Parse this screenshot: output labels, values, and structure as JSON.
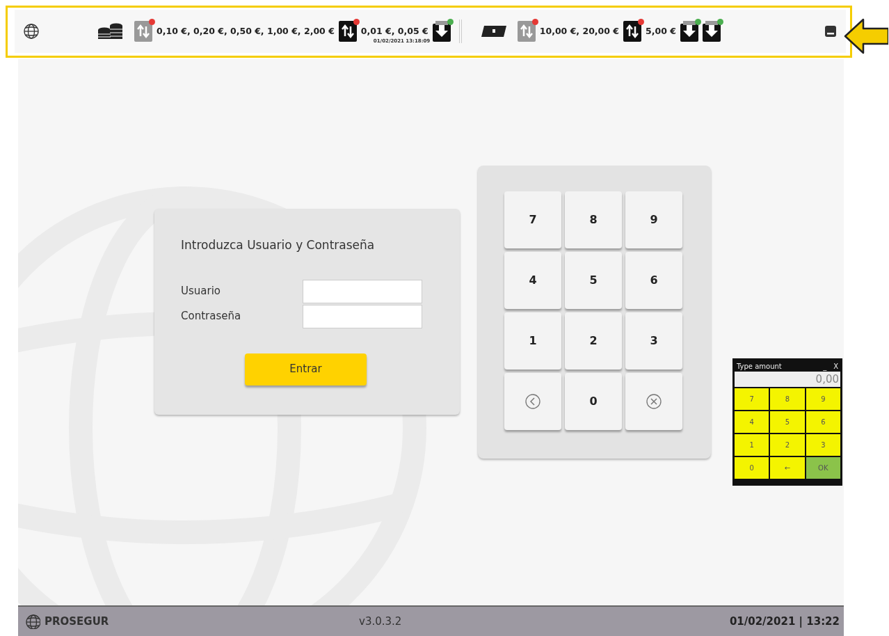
{
  "status_bar": {
    "items": [
      {
        "kind": "globe"
      },
      {
        "kind": "coins"
      },
      {
        "kind": "exchange",
        "dark": false,
        "color": "#e53935"
      },
      {
        "kind": "label",
        "text": "0,10 €, 0,20 €, 0,50 €, 1,00 €, 2,00 €"
      },
      {
        "kind": "exchange",
        "dark": true,
        "color": "#e53935"
      },
      {
        "kind": "label",
        "text": "0,01 €, 0,05 €",
        "timestamp": "01/02/2021 13:18:09"
      },
      {
        "kind": "deposit",
        "color": "#4caf50"
      },
      {
        "kind": "divider"
      },
      {
        "kind": "notes"
      },
      {
        "kind": "exchange",
        "dark": false,
        "color": "#e53935"
      },
      {
        "kind": "label",
        "text": "10,00 €, 20,00 €"
      },
      {
        "kind": "exchange",
        "dark": true,
        "color": "#e53935"
      },
      {
        "kind": "label",
        "text": "5,00 €"
      },
      {
        "kind": "deposit",
        "color": "#4caf50"
      },
      {
        "kind": "deposit",
        "color": "#4caf50"
      }
    ]
  },
  "login": {
    "title": "Introduzca Usuario y Contraseña",
    "fields": [
      {
        "label": "Usuario"
      },
      {
        "label": "Contraseña"
      }
    ],
    "button": "Entrar"
  },
  "keypad": {
    "keys": [
      {
        "kind": "digit",
        "text": "7"
      },
      {
        "kind": "digit",
        "text": "8"
      },
      {
        "kind": "digit",
        "text": "9"
      },
      {
        "kind": "digit",
        "text": "4"
      },
      {
        "kind": "digit",
        "text": "5"
      },
      {
        "kind": "digit",
        "text": "6"
      },
      {
        "kind": "digit",
        "text": "1"
      },
      {
        "kind": "digit",
        "text": "2"
      },
      {
        "kind": "digit",
        "text": "3"
      },
      {
        "kind": "back"
      },
      {
        "kind": "digit",
        "text": "0"
      },
      {
        "kind": "clear"
      }
    ]
  },
  "amount_window": {
    "title": "Type amount",
    "minimize": "_",
    "close": "X",
    "value": "0,00",
    "keys": [
      {
        "text": "7",
        "kind": "digit"
      },
      {
        "text": "8",
        "kind": "digit"
      },
      {
        "text": "9",
        "kind": "digit"
      },
      {
        "text": "4",
        "kind": "digit"
      },
      {
        "text": "5",
        "kind": "digit"
      },
      {
        "text": "6",
        "kind": "digit"
      },
      {
        "text": "1",
        "kind": "digit"
      },
      {
        "text": "2",
        "kind": "digit"
      },
      {
        "text": "3",
        "kind": "digit"
      },
      {
        "text": "0",
        "kind": "digit"
      },
      {
        "text": "←",
        "kind": "digit"
      },
      {
        "text": "OK",
        "kind": "ok"
      }
    ]
  },
  "footer": {
    "brand": "PROSEGUR",
    "version": "v3.0.3.2",
    "datetime": "01/02/2021 | 13:22"
  }
}
